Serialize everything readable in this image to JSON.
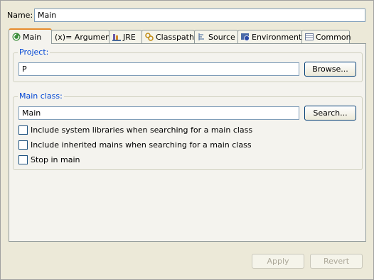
{
  "name": {
    "label": "Name:",
    "value": "Main"
  },
  "tabs": [
    {
      "label": "Main",
      "icon": "main-run-icon"
    },
    {
      "label": "(x)= Arguments",
      "icon": "arguments-icon"
    },
    {
      "label": "JRE",
      "icon": "jre-icon"
    },
    {
      "label": "Classpath",
      "icon": "classpath-icon"
    },
    {
      "label": "Source",
      "icon": "source-icon"
    },
    {
      "label": "Environment",
      "icon": "environment-icon"
    },
    {
      "label": "Common",
      "icon": "common-icon"
    }
  ],
  "project": {
    "label": "Project:",
    "value": "P",
    "browse": "Browse..."
  },
  "main_class": {
    "label": "Main class:",
    "value": "Main",
    "search": "Search..."
  },
  "options": [
    {
      "label": "Include system libraries when searching for a main class",
      "checked": false
    },
    {
      "label": "Include inherited mains when searching for a main class",
      "checked": false
    },
    {
      "label": "Stop in main",
      "checked": false
    }
  ],
  "buttons": {
    "apply": "Apply",
    "revert": "Revert"
  }
}
